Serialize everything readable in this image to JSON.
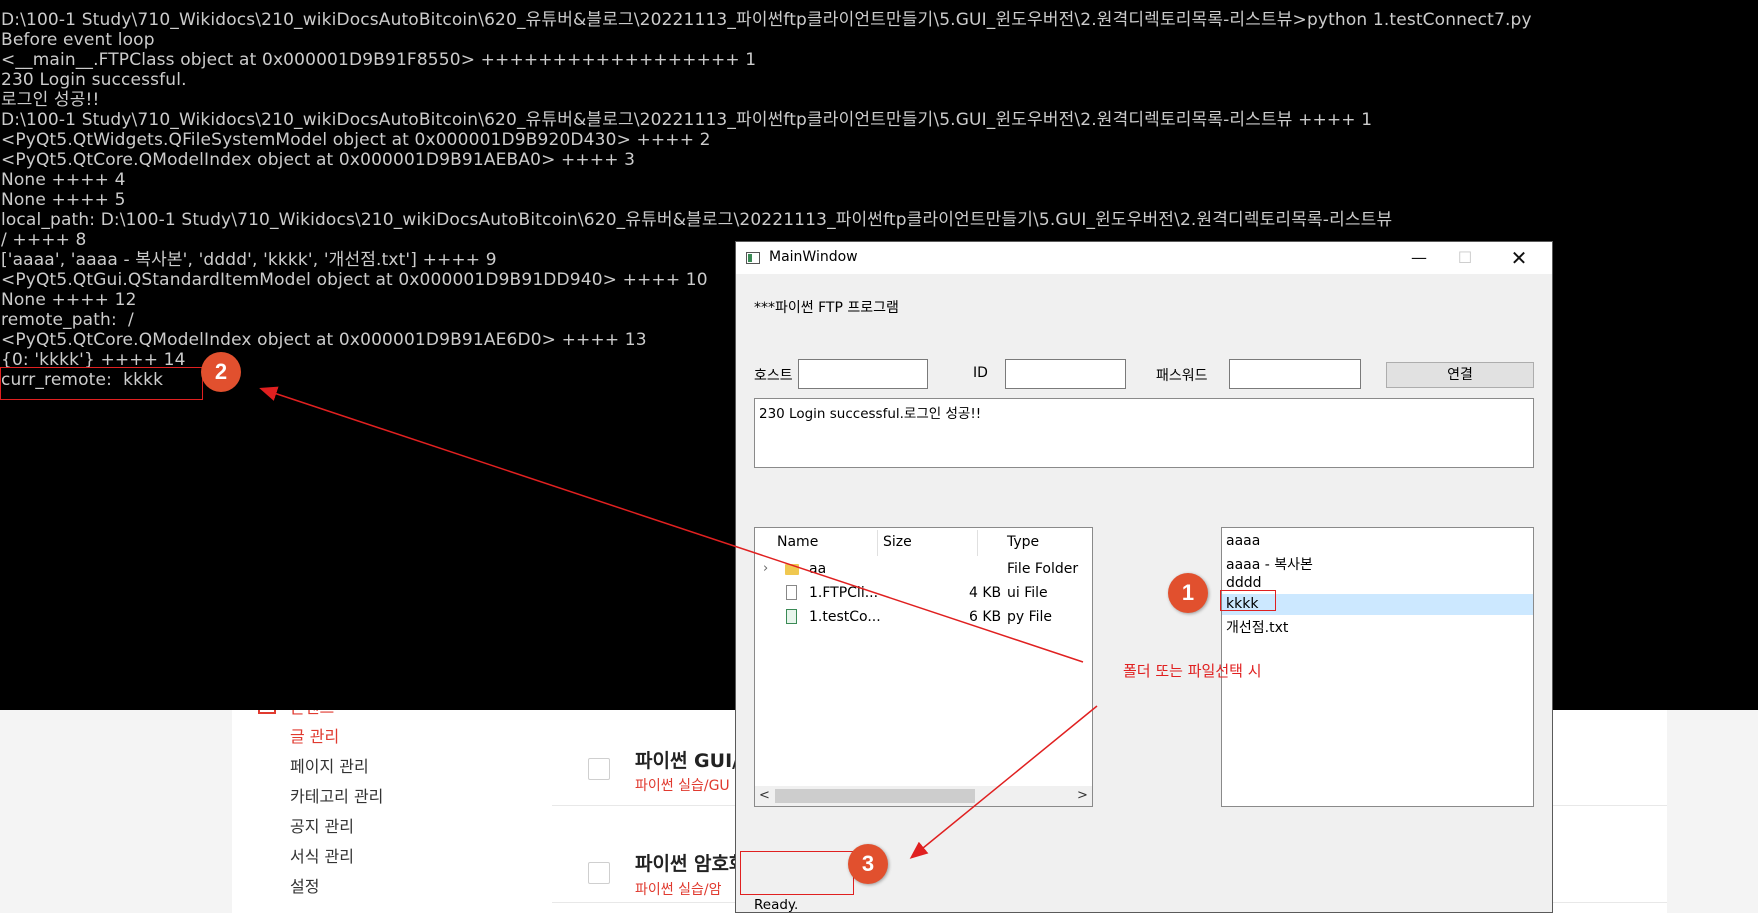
{
  "terminal": {
    "lines": [
      "D:\\100-1 Study\\710_Wikidocs\\210_wikiDocsAutoBitcoin\\620_유튜버&블로그\\20221113_파이썬ftp클라이언트만들기\\5.GUI_윈도우버전\\2.원격디렉토리목록-리스트뷰>python 1.testConnect7.py",
      "Before event loop",
      "<__main__.FTPClass object at 0x000001D9B91F8550> ++++++++++++++++++ 1",
      "230 Login successful.",
      "로그인 성공!!",
      "D:\\100-1 Study\\710_Wikidocs\\210_wikiDocsAutoBitcoin\\620_유튜버&블로그\\20221113_파이썬ftp클라이언트만들기\\5.GUI_윈도우버전\\2.원격디렉토리목록-리스트뷰 ++++ 1",
      "<PyQt5.QtWidgets.QFileSystemModel object at 0x000001D9B920D430> ++++ 2",
      "<PyQt5.QtCore.QModelIndex object at 0x000001D9B91AEBA0> ++++ 3",
      "None ++++ 4",
      "None ++++ 5",
      "local_path: D:\\100-1 Study\\710_Wikidocs\\210_wikiDocsAutoBitcoin\\620_유튜버&블로그\\20221113_파이썬ftp클라이언트만들기\\5.GUI_윈도우버전\\2.원격디렉토리목록-리스트뷰",
      "/ ++++ 8",
      "['aaaa', 'aaaa - 복사본', 'dddd', 'kkkk', '개선점.txt'] ++++ 9",
      "<PyQt5.QtGui.QStandardItemModel object at 0x000001D9B91DD940> ++++ 10",
      "None ++++ 12",
      "remote_path:  /",
      "<PyQt5.QtCore.QModelIndex object at 0x000001D9B91AE6D0> ++++ 13",
      "{0: 'kkkk'} ++++ 14",
      "curr_remote:  kkkk"
    ]
  },
  "window": {
    "title": "MainWindow",
    "min_glyph": "—",
    "max_glyph": "☐",
    "close_glyph": "✕"
  },
  "app": {
    "heading": "***파이썬 FTP 프로그램",
    "host_label": "호스트",
    "id_label": "ID",
    "password_label": "패스워드",
    "host_value": "",
    "id_value": "",
    "password_value": "",
    "connect_label": "연결",
    "log_text": "230 Login successful.로그인 성공!!",
    "status": "Ready."
  },
  "local_view": {
    "columns": [
      "Name",
      "Size",
      "Type"
    ],
    "rows": [
      {
        "name": "aa",
        "size": "",
        "type": "File Folder"
      },
      {
        "name": "1.FTPCli...",
        "size": "4 KB",
        "type": "ui File"
      },
      {
        "name": "1.testCo...",
        "size": "6 KB",
        "type": "py File"
      }
    ],
    "scroll_left": "<",
    "scroll_right": ">",
    "expander": "›"
  },
  "remote_view": {
    "items": [
      "aaaa",
      "aaaa - 복사본",
      "dddd",
      "kkkk",
      "개선점.txt"
    ],
    "selected": "kkkk"
  },
  "annotations": {
    "badge1": "1",
    "badge2": "2",
    "badge3": "3",
    "note": "폴더 또는 파일선택 시",
    "accent": "#e02020",
    "badge_color": "#e1502e"
  },
  "blog": {
    "sidebar_top": "콘텐츠",
    "sidebar_items": [
      "글 관리",
      "페이지 관리",
      "카테고리 관리",
      "공지 관리",
      "서식 관리",
      "설정"
    ],
    "posts": [
      {
        "title": "파이썬 GUI/",
        "category": "파이썬 실습/GU"
      },
      {
        "title": "파이썬 암호화",
        "category": "파이썬 실습/암"
      }
    ]
  }
}
